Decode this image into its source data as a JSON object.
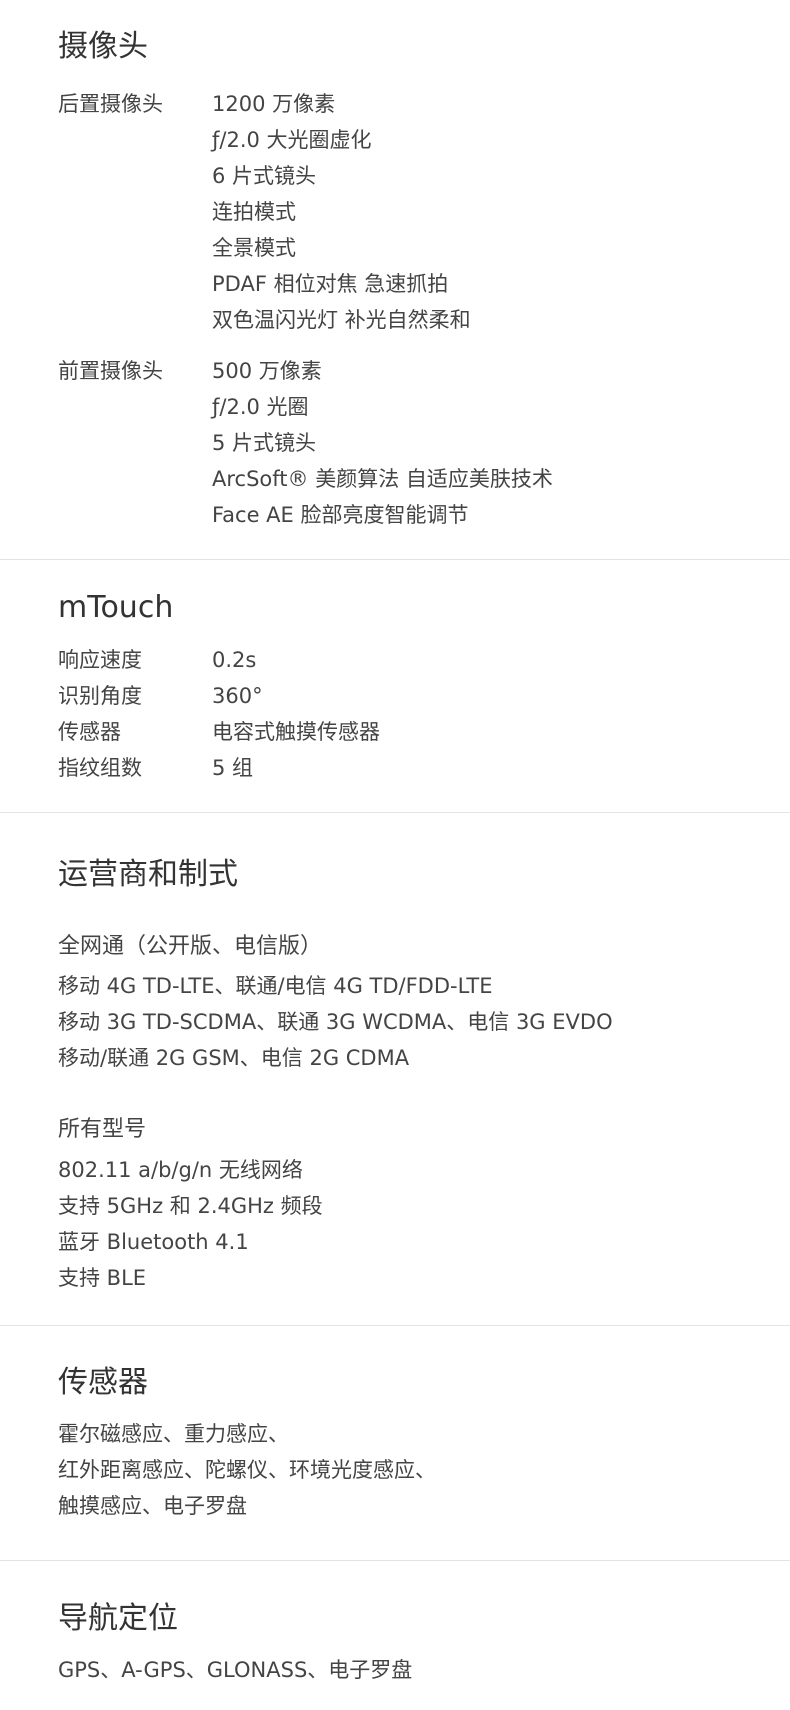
{
  "camera": {
    "title": "摄像头",
    "rear": {
      "label": "后置摄像头",
      "values": [
        "1200 万像素",
        "ƒ/2.0 大光圈虚化",
        "6 片式镜头",
        "连拍模式",
        "全景模式",
        "PDAF 相位对焦 急速抓拍",
        "双色温闪光灯 补光自然柔和"
      ]
    },
    "front": {
      "label": "前置摄像头",
      "values": [
        "500 万像素",
        "ƒ/2.0 光圈",
        "5 片式镜头",
        "ArcSoft® 美颜算法  自适应美肤技术",
        "Face AE 脸部亮度智能调节"
      ]
    }
  },
  "mtouch": {
    "title": "mTouch",
    "rows": [
      {
        "label": "响应速度",
        "value": "0.2s"
      },
      {
        "label": "识别角度",
        "value": "360°"
      },
      {
        "label": "传感器",
        "value": "电容式触摸传感器"
      },
      {
        "label": "指纹组数",
        "value": "5 组"
      }
    ]
  },
  "carrier": {
    "title": "运营商和制式",
    "group1": {
      "heading": "全网通（公开版、电信版）",
      "lines": [
        "移动 4G TD-LTE、联通/电信 4G TD/FDD-LTE",
        "移动 3G TD-SCDMA、联通 3G WCDMA、电信 3G EVDO",
        "移动/联通 2G GSM、电信 2G CDMA"
      ]
    },
    "group2": {
      "heading": "所有型号",
      "lines": [
        "802.11 a/b/g/n 无线网络",
        "支持 5GHz 和 2.4GHz 频段",
        "蓝牙 Bluetooth 4.1",
        "支持 BLE"
      ]
    }
  },
  "sensors": {
    "title": "传感器",
    "lines": [
      "霍尔磁感应、重力感应、",
      "红外距离感应、陀螺仪、环境光度感应、",
      "触摸感应、电子罗盘"
    ]
  },
  "navigation": {
    "title": "导航定位",
    "lines": [
      "GPS、A-GPS、GLONASS、电子罗盘"
    ]
  }
}
